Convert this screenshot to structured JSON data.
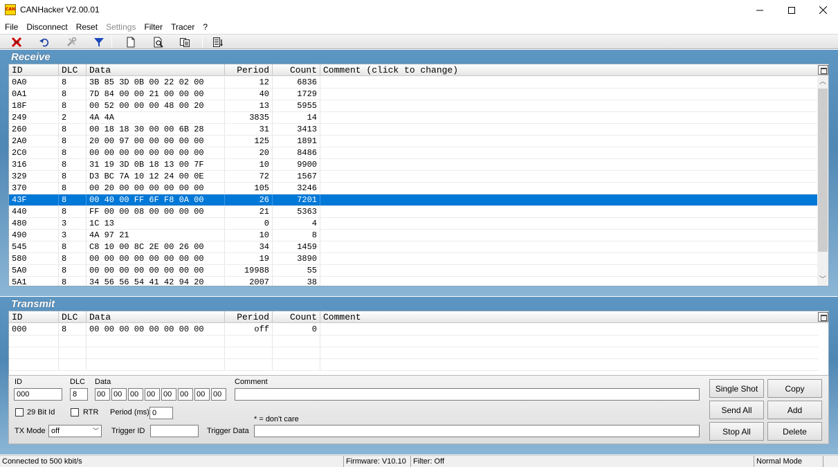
{
  "window": {
    "title": "CANHacker V2.00.01",
    "icon_text": "CAN"
  },
  "menu": [
    "File",
    "Disconnect",
    "Reset",
    "Settings",
    "Filter",
    "Tracer",
    "?"
  ],
  "toolbar": {
    "icons": [
      "disconnect-icon",
      "undo-icon",
      "tools-icon",
      "filter-icon",
      "new-document-icon",
      "print-preview-icon",
      "copy-icon",
      "trace-list-icon"
    ]
  },
  "receive": {
    "title": "Receive",
    "columns": {
      "id": "ID",
      "dlc": "DLC",
      "data": "Data",
      "period": "Period",
      "count": "Count",
      "comment": "Comment (click to change)"
    },
    "selected_index": 10,
    "rows": [
      {
        "id": "0A0",
        "dlc": "8",
        "data": "3B 85 3D 0B 00 22 02 00",
        "period": "12",
        "count": "6836"
      },
      {
        "id": "0A1",
        "dlc": "8",
        "data": "7D 84 00 00 21 00 00 00",
        "period": "40",
        "count": "1729"
      },
      {
        "id": "18F",
        "dlc": "8",
        "data": "00 52 00 00 00 48 00 20",
        "period": "13",
        "count": "5955"
      },
      {
        "id": "249",
        "dlc": "2",
        "data": "4A 4A",
        "period": "3835",
        "count": "14"
      },
      {
        "id": "260",
        "dlc": "8",
        "data": "00 18 18 30 00 00 6B 28",
        "period": "31",
        "count": "3413"
      },
      {
        "id": "2A0",
        "dlc": "8",
        "data": "20 00 97 00 00 00 00 00",
        "period": "125",
        "count": "1891"
      },
      {
        "id": "2C0",
        "dlc": "8",
        "data": "00 00 00 00 00 00 00 00",
        "period": "20",
        "count": "8486"
      },
      {
        "id": "316",
        "dlc": "8",
        "data": "31 19 3D 0B 18 13 00 7F",
        "period": "10",
        "count": "9900"
      },
      {
        "id": "329",
        "dlc": "8",
        "data": "D3 BC 7A 10 12 24 00 0E",
        "period": "72",
        "count": "1567"
      },
      {
        "id": "370",
        "dlc": "8",
        "data": "00 20 00 00 00 00 00 00",
        "period": "105",
        "count": "3246"
      },
      {
        "id": "43F",
        "dlc": "8",
        "data": "00 40 00 FF 6F F8 0A 00",
        "period": "26",
        "count": "7201"
      },
      {
        "id": "440",
        "dlc": "8",
        "data": "FF 00 00 08 00 00 00 00",
        "period": "21",
        "count": "5363"
      },
      {
        "id": "480",
        "dlc": "3",
        "data": "1C 13",
        "period": "0",
        "count": "4"
      },
      {
        "id": "490",
        "dlc": "3",
        "data": "4A 97 21",
        "period": "10",
        "count": "8"
      },
      {
        "id": "545",
        "dlc": "8",
        "data": "C8 10 00 8C 2E 00 26 00",
        "period": "34",
        "count": "1459"
      },
      {
        "id": "580",
        "dlc": "8",
        "data": "00 00 00 00 00 00 00 00",
        "period": "19",
        "count": "3890"
      },
      {
        "id": "5A0",
        "dlc": "8",
        "data": "00 00 00 00 00 00 00 00",
        "period": "19988",
        "count": "55"
      },
      {
        "id": "5A1",
        "dlc": "8",
        "data": "34 56 56 54 41 42 94 20",
        "period": "2007",
        "count": "38"
      }
    ]
  },
  "transmit": {
    "title": "Transmit",
    "columns": {
      "id": "ID",
      "dlc": "DLC",
      "data": "Data",
      "period": "Period",
      "count": "Count",
      "comment": "Comment"
    },
    "rows": [
      {
        "id": "000",
        "dlc": "8",
        "data": "00 00 00 00 00 00 00 00",
        "period": "off",
        "count": "0"
      }
    ]
  },
  "editor": {
    "id_label": "ID",
    "id_value": "000",
    "dlc_label": "DLC",
    "dlc_value": "8",
    "data_label": "Data",
    "data_bytes": [
      "00",
      "00",
      "00",
      "00",
      "00",
      "00",
      "00",
      "00"
    ],
    "comment_label": "Comment",
    "comment_value": "",
    "ext_label": "29 Bit Id",
    "rtr_label": "RTR",
    "period_label": "Period (ms)",
    "period_value": "0",
    "dont_care_note": "* = don't care",
    "tx_mode_label": "TX Mode",
    "tx_mode_value": "off",
    "trigger_id_label": "Trigger ID",
    "trigger_id_value": "",
    "trigger_data_label": "Trigger Data",
    "trigger_data_value": "",
    "buttons": {
      "single_shot": "Single Shot",
      "copy": "Copy",
      "send_all": "Send All",
      "add": "Add",
      "stop_all": "Stop All",
      "delete": "Delete"
    }
  },
  "status": {
    "connection": "Connected to 500 kbit/s",
    "firmware": "Firmware: V10.10",
    "filter": "Filter: Off",
    "mode": "Normal Mode"
  },
  "colors": {
    "selection": "#0078d7",
    "panel": "#4f87b4"
  }
}
